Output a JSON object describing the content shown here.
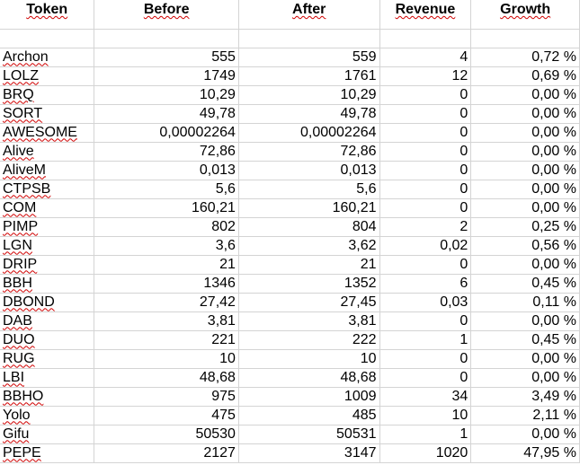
{
  "headers": [
    "Token",
    "Before",
    "After",
    "Revenue",
    "Growth"
  ],
  "rows": [
    {
      "token": "Archon",
      "before": "555",
      "after": "559",
      "revenue": "4",
      "growth": "0,72 %"
    },
    {
      "token": "LOLZ",
      "before": "1749",
      "after": "1761",
      "revenue": "12",
      "growth": "0,69 %"
    },
    {
      "token": "BRQ",
      "before": "10,29",
      "after": "10,29",
      "revenue": "0",
      "growth": "0,00 %"
    },
    {
      "token": "SORT",
      "before": "49,78",
      "after": "49,78",
      "revenue": "0",
      "growth": "0,00 %"
    },
    {
      "token": "AWESOME",
      "before": "0,00002264",
      "after": "0,00002264",
      "revenue": "0",
      "growth": "0,00 %"
    },
    {
      "token": "Alive",
      "before": "72,86",
      "after": "72,86",
      "revenue": "0",
      "growth": "0,00 %"
    },
    {
      "token": "AliveM",
      "before": "0,013",
      "after": "0,013",
      "revenue": "0",
      "growth": "0,00 %"
    },
    {
      "token": "CTPSB",
      "before": "5,6",
      "after": "5,6",
      "revenue": "0",
      "growth": "0,00 %"
    },
    {
      "token": "COM",
      "before": "160,21",
      "after": "160,21",
      "revenue": "0",
      "growth": "0,00 %"
    },
    {
      "token": "PIMP",
      "before": "802",
      "after": "804",
      "revenue": "2",
      "growth": "0,25 %"
    },
    {
      "token": "LGN",
      "before": "3,6",
      "after": "3,62",
      "revenue": "0,02",
      "growth": "0,56 %"
    },
    {
      "token": "DRIP",
      "before": "21",
      "after": "21",
      "revenue": "0",
      "growth": "0,00 %"
    },
    {
      "token": "BBH",
      "before": "1346",
      "after": "1352",
      "revenue": "6",
      "growth": "0,45 %"
    },
    {
      "token": "DBOND",
      "before": "27,42",
      "after": "27,45",
      "revenue": "0,03",
      "growth": "0,11 %"
    },
    {
      "token": "DAB",
      "before": "3,81",
      "after": "3,81",
      "revenue": "0",
      "growth": "0,00 %"
    },
    {
      "token": "DUO",
      "before": "221",
      "after": "222",
      "revenue": "1",
      "growth": "0,45 %"
    },
    {
      "token": "RUG",
      "before": "10",
      "after": "10",
      "revenue": "0",
      "growth": "0,00 %"
    },
    {
      "token": "LBI",
      "before": "48,68",
      "after": "48,68",
      "revenue": "0",
      "growth": "0,00 %"
    },
    {
      "token": "BBHO",
      "before": "975",
      "after": "1009",
      "revenue": "34",
      "growth": "3,49 %"
    },
    {
      "token": "Yolo",
      "before": "475",
      "after": "485",
      "revenue": "10",
      "growth": "2,11 %"
    },
    {
      "token": "Gifu",
      "before": "50530",
      "after": "50531",
      "revenue": "1",
      "growth": "0,00 %"
    },
    {
      "token": "PEPE",
      "before": "2127",
      "after": "3147",
      "revenue": "1020",
      "growth": "47,95 %"
    }
  ]
}
